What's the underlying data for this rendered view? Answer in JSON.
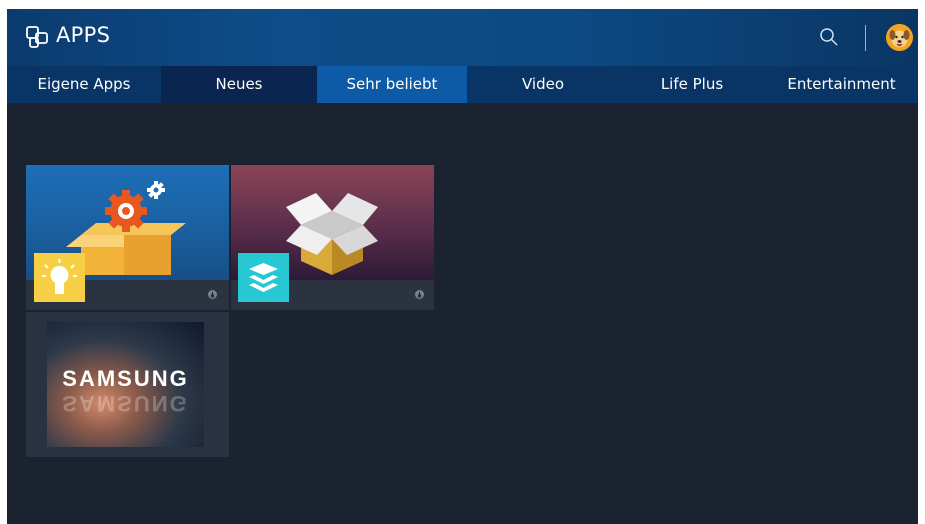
{
  "header": {
    "title": "APPS",
    "logo_icon": "apps-grid-icon",
    "search_icon": "search-icon",
    "avatar_icon": "dog-avatar-icon"
  },
  "tabs": [
    {
      "label": "Eigene Apps"
    },
    {
      "label": "Neues"
    },
    {
      "label": "Sehr beliebt"
    },
    {
      "label": "Video"
    },
    {
      "label": "Life Plus"
    },
    {
      "label": "Entertainment"
    }
  ],
  "active_tab": "Neues",
  "highlighted_tab": "Sehr beliebt",
  "tiles": [
    {
      "thumbnail": "gear-box-icon",
      "badge_icon": "lightbulb-icon",
      "download_icon": "download-icon"
    },
    {
      "thumbnail": "open-box-icon",
      "badge_icon": "layers-icon",
      "download_icon": "download-icon"
    },
    {
      "brand_text": "SAMSUNG"
    }
  ],
  "colors": {
    "header": "#0e4d8a",
    "tab_bar": "#083566",
    "active_tab": "#0a2550",
    "highlighted_tab": "#0d5aa6",
    "background": "#1b2230"
  }
}
